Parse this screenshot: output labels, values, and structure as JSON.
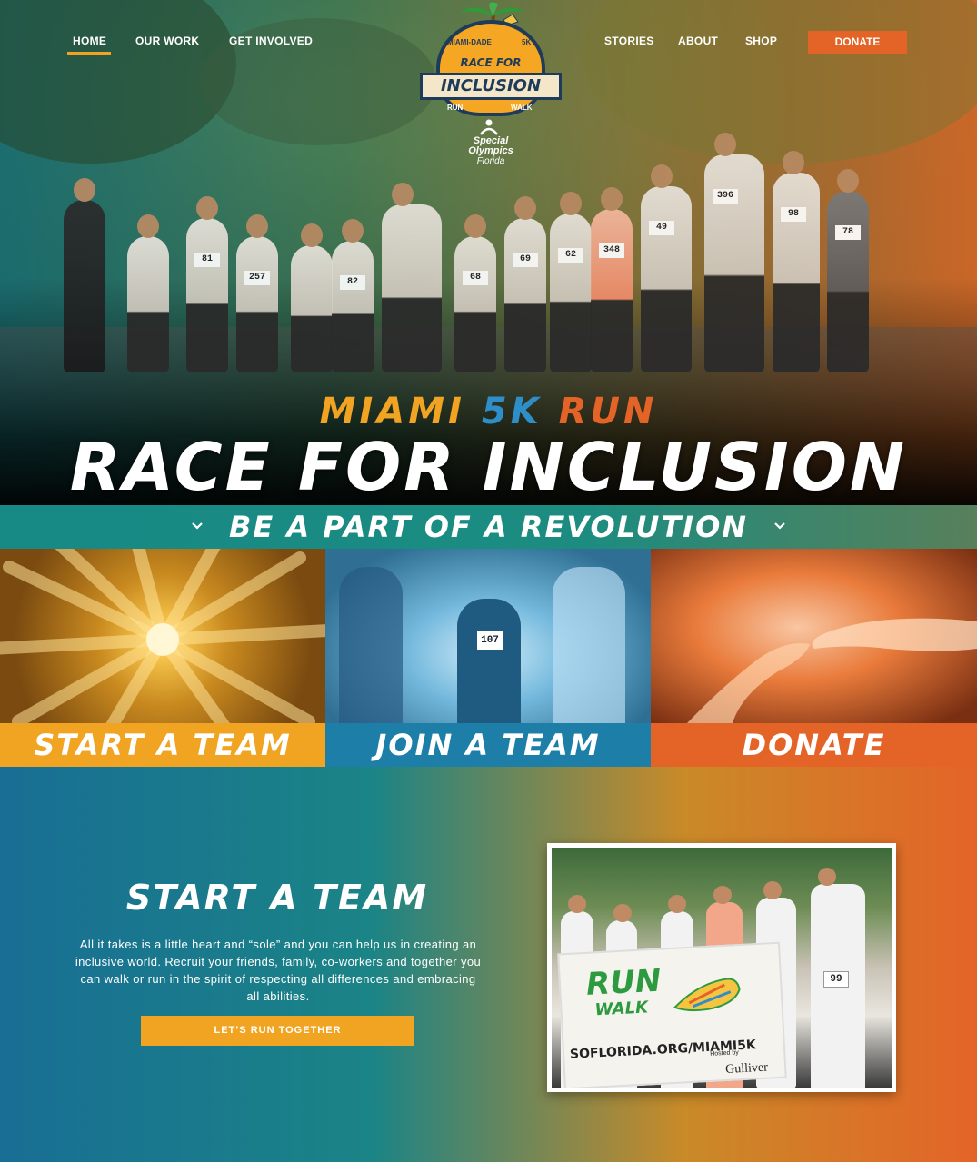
{
  "nav": {
    "left": [
      "HOME",
      "OUR WORK",
      "GET INVOLVED"
    ],
    "right": [
      "STORIES",
      "ABOUT",
      "SHOP"
    ],
    "donate": "DONATE",
    "active": "HOME"
  },
  "logo": {
    "top_left": "MIAMI-DADE",
    "top_right": "5K",
    "race_for": "RACE FOR",
    "inclusion": "INCLUSION",
    "run": "RUN",
    "walk": "WALK",
    "org_line1": "Special",
    "org_line2": "Olympics",
    "org_line3": "Florida"
  },
  "hero": {
    "subtitle_words": [
      "MIAMI",
      "5K",
      "RUN"
    ],
    "title": "RACE FOR INCLUSION",
    "bibs": [
      "81",
      "257",
      "82",
      "68",
      "69",
      "62",
      "348",
      "49",
      "396",
      "98",
      "78"
    ]
  },
  "band": {
    "text": "BE A PART OF A REVOLUTION"
  },
  "tiles": [
    {
      "label": "START A TEAM"
    },
    {
      "label": "JOIN A TEAM",
      "bib": "107"
    },
    {
      "label": "DONATE"
    }
  ],
  "start_team": {
    "title": "START A TEAM",
    "body": "All it takes is a little heart and “sole” and you can help us in creating an inclusive world. Recruit your friends, family, co-workers and together you can walk or run in the spirit of respecting all differences and embracing all abilities.",
    "cta": "LET’S RUN TOGETHER"
  },
  "photo_sign": {
    "run": "RUN",
    "walk": "WALK",
    "url": "SOFLORIDA.ORG/MIAMI5K",
    "hosted": "Hosted by",
    "host": "Gulliver",
    "bib": "99"
  },
  "colors": {
    "orange": "#e46428",
    "yellow": "#f0a422",
    "blue": "#1d7fa8",
    "teal": "#178a86"
  }
}
